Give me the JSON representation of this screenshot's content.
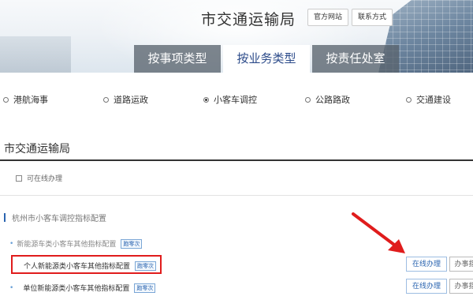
{
  "header": {
    "title": "市交通运输局",
    "official_site": "官方网站",
    "contact": "联系方式"
  },
  "tabs": [
    {
      "label": "按事项类型",
      "active": false
    },
    {
      "label": "按业务类型",
      "active": true
    },
    {
      "label": "按责任处室",
      "active": false
    }
  ],
  "categories": [
    {
      "label": "港航海事",
      "checked": false
    },
    {
      "label": "道路运政",
      "checked": false
    },
    {
      "label": "小客车调控",
      "checked": true
    },
    {
      "label": "公路路政",
      "checked": false
    },
    {
      "label": "交通建设",
      "checked": false
    }
  ],
  "section": {
    "title": "市交通运输局",
    "online_filter": "可在线办理"
  },
  "group": {
    "title": "杭州市小客车调控指标配置",
    "items": [
      {
        "label": "新能源车类小客车其他指标配置",
        "tag": "跑零次"
      },
      {
        "label": "个人新能源类小客车其他指标配置",
        "tag": "跑零次"
      },
      {
        "label": "单位新能源类小客车其他指标配置",
        "tag": "跑零次"
      }
    ]
  },
  "actions": {
    "online": "在线办理",
    "guide": "办事指"
  },
  "colors": {
    "accent": "#2a64b0",
    "highlight": "#e01c1c"
  }
}
